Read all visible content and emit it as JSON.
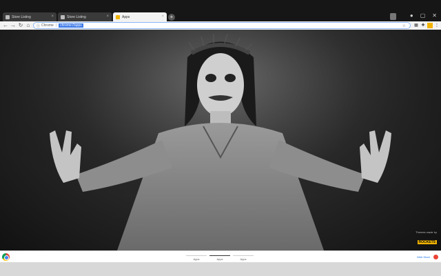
{
  "tabs": [
    {
      "label": "Store Listing",
      "active": false
    },
    {
      "label": "Store Listing",
      "active": false
    },
    {
      "label": "Apps",
      "active": true
    }
  ],
  "toolbar": {
    "back": "←",
    "forward": "→",
    "reload": "↻",
    "home": "⌂",
    "site_chip": "Chrome",
    "separator": "|",
    "url": "chrome://apps",
    "star": "☆"
  },
  "credit": {
    "line1": "Themes made by",
    "brand": "ROCKETS"
  },
  "bottom": {
    "tabs": [
      "Apps",
      "Apps",
      "Apps"
    ],
    "active_index": 1,
    "webstore": "Web Store"
  },
  "colors": {
    "accent": "#3b78e7",
    "brand": "#f2b300"
  },
  "icons": {
    "new_tab": "plus-icon",
    "menu": "kebab-menu-icon"
  }
}
